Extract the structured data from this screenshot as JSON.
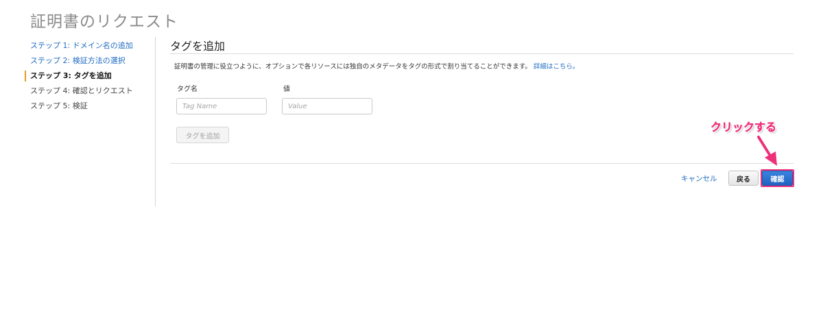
{
  "page": {
    "title": "証明書のリクエスト"
  },
  "steps": [
    {
      "label": "ステップ 1: ドメイン名の追加",
      "state": "link"
    },
    {
      "label": "ステップ 2: 検証方法の選択",
      "state": "link"
    },
    {
      "label": "ステップ 3: タグを追加",
      "state": "current"
    },
    {
      "label": "ステップ 4: 確認とリクエスト",
      "state": "future"
    },
    {
      "label": "ステップ 5: 検証",
      "state": "future"
    }
  ],
  "section": {
    "title": "タグを追加",
    "description": "証明書の管理に役立つように、オプションで各リソースには独自のメタデータをタグの形式で割り当てることができます。",
    "details_link": "詳細はこちら。"
  },
  "tag_form": {
    "name_label": "タグ名",
    "value_label": "値",
    "name_placeholder": "Tag Name",
    "value_placeholder": "Value",
    "name_value": "",
    "value_value": "",
    "add_button": "タグを追加"
  },
  "footer": {
    "cancel": "キャンセル",
    "back": "戻る",
    "confirm": "確認"
  },
  "annotation": {
    "text": "クリックする",
    "color": "#ee2f7a"
  },
  "colors": {
    "link": "#1e6ac2",
    "current_step_marker": "#e79a21",
    "primary_button": "#1f63c2"
  }
}
